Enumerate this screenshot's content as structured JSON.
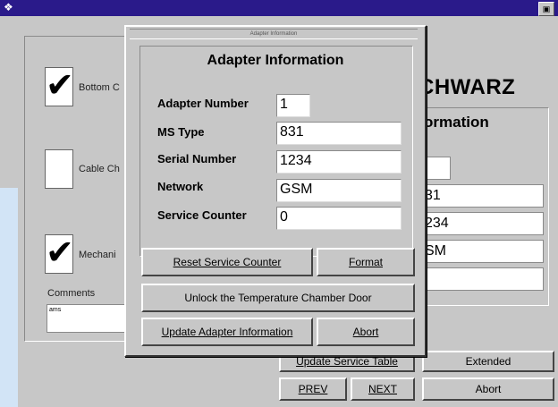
{
  "window": {
    "system_icon": "❖",
    "control": "▣"
  },
  "background": {
    "checkboxes": [
      {
        "label": "Bottom C",
        "checked": true
      },
      {
        "label": "Cable Ch",
        "checked": false
      },
      {
        "label": "Mechani",
        "checked": true
      }
    ],
    "comments_label": "Comments",
    "comments_value": "ams",
    "brand": "CHWARZ",
    "info_header": "ormation",
    "fields": [
      "",
      "31",
      "234",
      "SM",
      ""
    ],
    "buttons": {
      "update_service_table": "Update Service Table",
      "extended": "Extended",
      "prev": "PREV",
      "next": "NEXT",
      "abort": "Abort"
    }
  },
  "dialog": {
    "title": "Adapter Information",
    "heading": "Adapter Information",
    "fields": {
      "adapter_number": {
        "label": "Adapter Number",
        "value": "1"
      },
      "ms_type": {
        "label": "MS Type",
        "value": "831"
      },
      "serial_number": {
        "label": "Serial Number",
        "value": "1234"
      },
      "network": {
        "label": "Network",
        "value": "GSM"
      },
      "service_counter": {
        "label": "Service Counter",
        "value": "0"
      }
    },
    "buttons": {
      "reset_service_counter": "Reset Service Counter",
      "format": "Format",
      "unlock_door": "Unlock the Temperature Chamber Door",
      "update_adapter_info": "Update Adapter Information",
      "abort": "Abort"
    }
  }
}
